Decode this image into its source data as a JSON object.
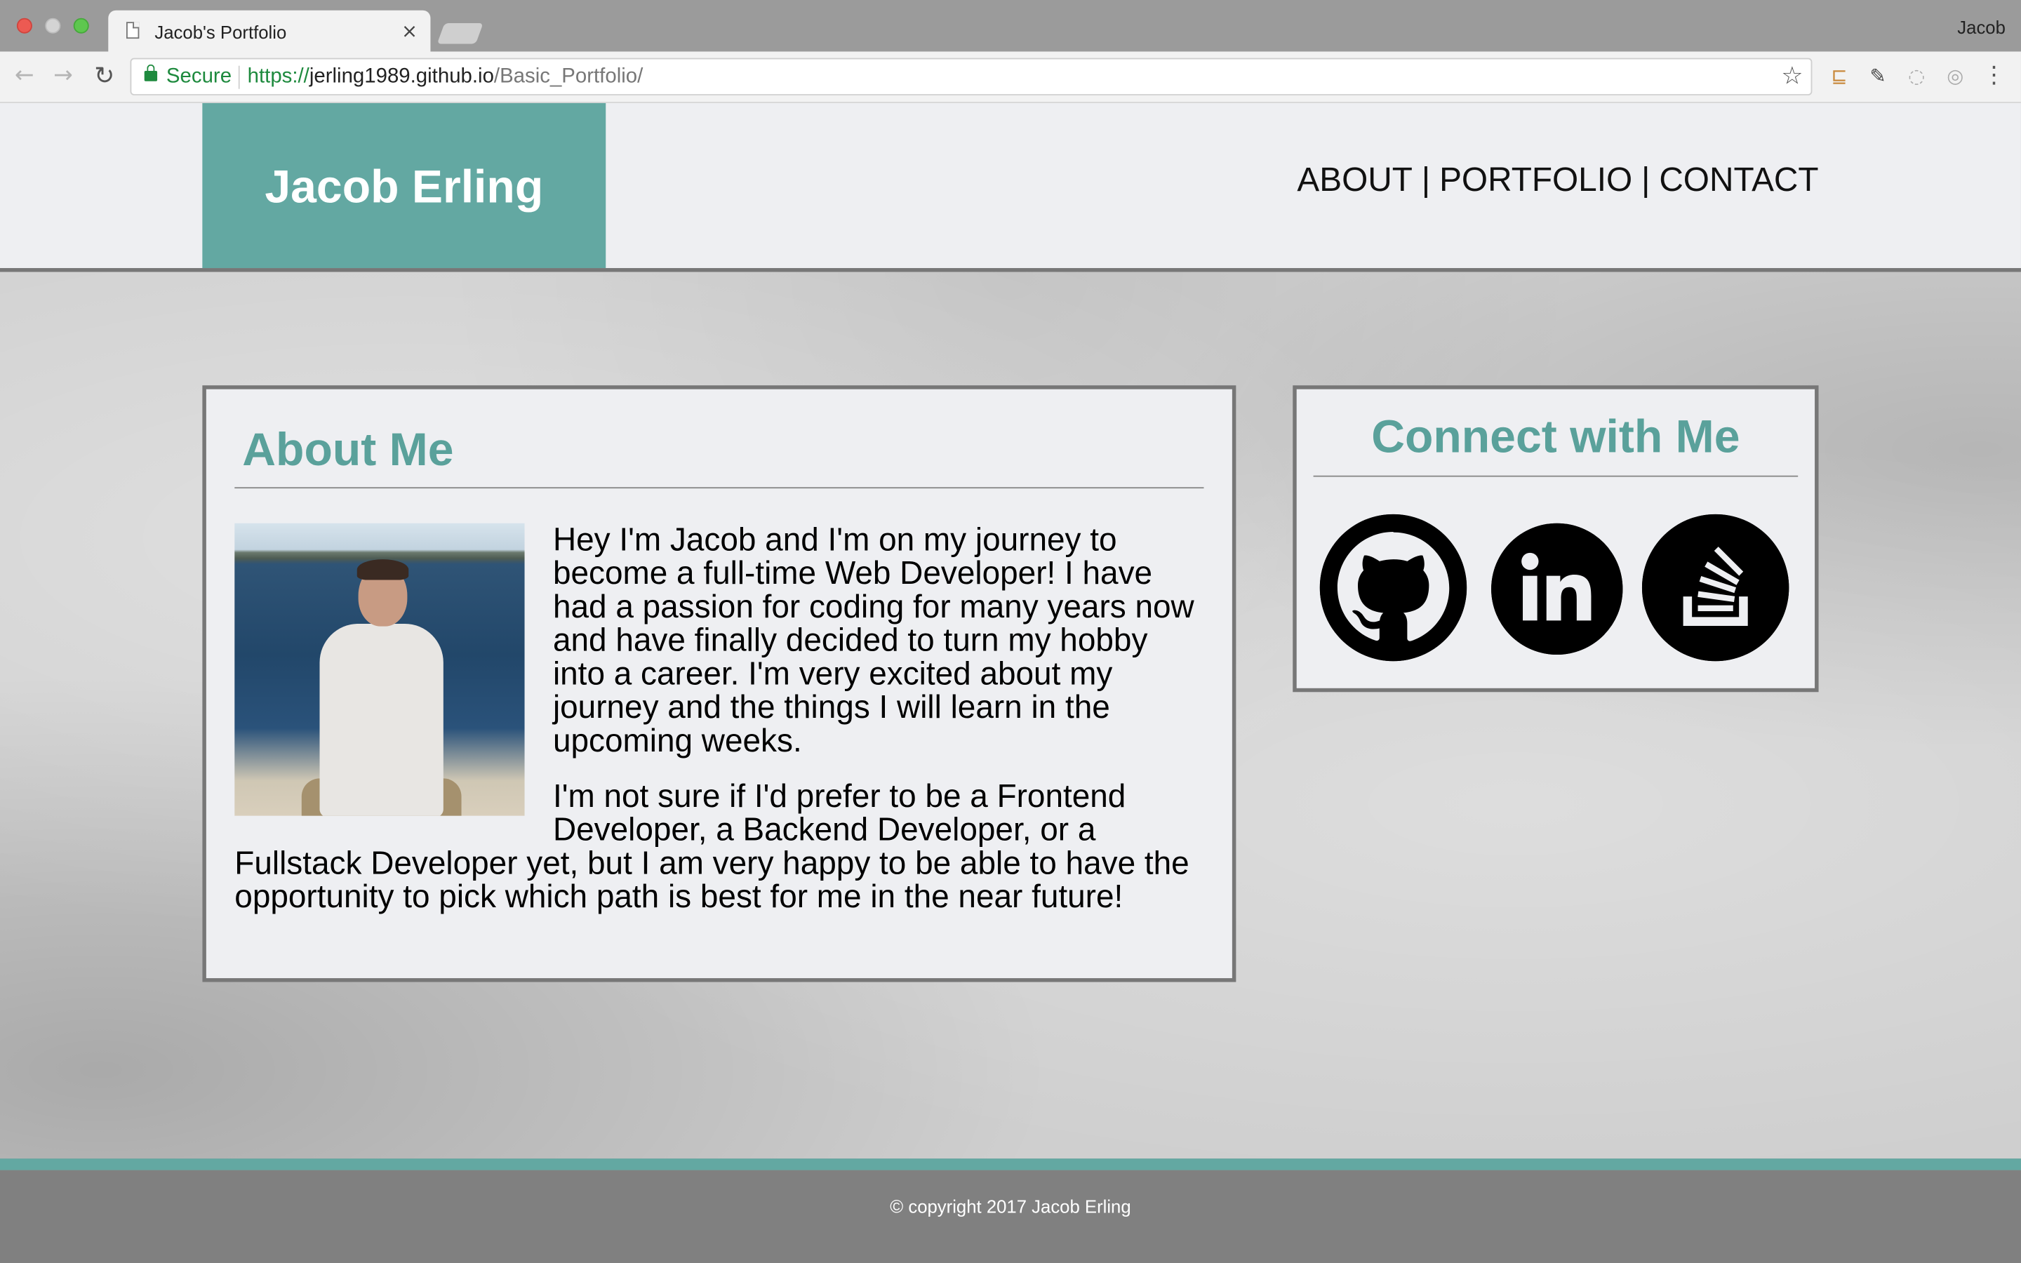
{
  "browser": {
    "tab_title": "Jacob's Portfolio",
    "tab_close": "×",
    "profile_name": "Jacob",
    "secure_label": "Secure",
    "url_scheme": "https://",
    "url_host": "jerling1989.github.io",
    "url_path": "/Basic_Portfolio/",
    "icons": [
      "back-icon",
      "forward-icon",
      "reload-icon",
      "lock-icon",
      "star-icon",
      "extension-icon"
    ]
  },
  "header": {
    "brand_name": "Jacob Erling",
    "nav": [
      {
        "label": "ABOUT"
      },
      {
        "label": "PORTFOLIO"
      },
      {
        "label": "CONTACT"
      }
    ],
    "nav_separator": "|",
    "brand_color": "#63a8a2"
  },
  "about": {
    "title": "About Me",
    "paragraphs": [
      "Hey I'm Jacob and I'm on my journey to become a full-time Web Developer! I have had a passion for coding for many years now and have finally decided to turn my hobby into a career. I'm very excited about my journey and the things I will learn in the upcoming weeks.",
      "I'm not sure if I'd prefer to be a Frontend Developer, a Backend Developer, or a Fullstack Developer yet, but I am very happy to be able to have the opportunity to pick which path is best for me in the near future!"
    ]
  },
  "connect": {
    "title": "Connect with Me",
    "links": [
      {
        "name": "GitHub",
        "icon": "github-icon"
      },
      {
        "name": "LinkedIn",
        "icon": "linkedin-icon"
      },
      {
        "name": "Stack Overflow",
        "icon": "stackoverflow-icon"
      }
    ]
  },
  "footer": {
    "text": "© copyright 2017 Jacob Erling"
  },
  "colors": {
    "accent": "#63a8a2",
    "heading": "#5aa19b",
    "footer_bg": "#808080"
  }
}
